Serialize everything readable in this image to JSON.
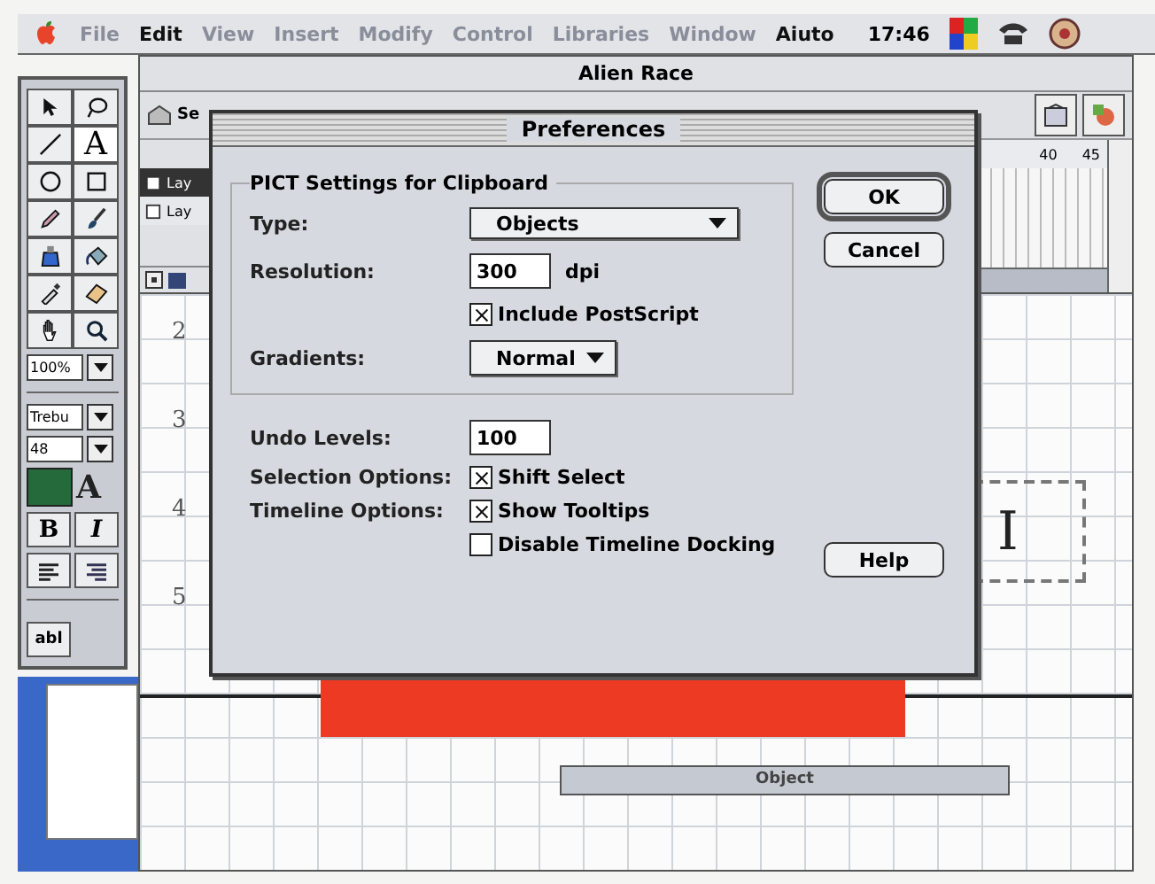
{
  "menu_bar": {
    "items": [
      {
        "label": "File",
        "disabled": true
      },
      {
        "label": "Edit",
        "disabled": false
      },
      {
        "label": "View",
        "disabled": true
      },
      {
        "label": "Insert",
        "disabled": true
      },
      {
        "label": "Modify",
        "disabled": true
      },
      {
        "label": "Control",
        "disabled": true
      },
      {
        "label": "Libraries",
        "disabled": true
      },
      {
        "label": "Window",
        "disabled": true
      },
      {
        "label": "Aiuto",
        "disabled": false
      }
    ],
    "clock": "17:46"
  },
  "window": {
    "title": "Alien Race"
  },
  "toolbar": {
    "scene_label": "Se"
  },
  "timeline": {
    "layers": [
      {
        "name": "Lay",
        "selected": true
      },
      {
        "name": "Lay",
        "selected": false
      }
    ],
    "ruler_labels": [
      "40",
      "45"
    ]
  },
  "tools": {
    "text_tool": "A",
    "zoom": "100%",
    "font": "Trebu",
    "size": "48",
    "text_color_label": "A",
    "bold": "B",
    "italic": "I",
    "text_field": "abl"
  },
  "stage": {
    "row_numbers": [
      "2",
      "3",
      "4",
      "5"
    ],
    "text_fragment": "I",
    "object_label": "Object"
  },
  "dialog": {
    "title": "Preferences",
    "group_title": "PICT Settings for Clipboard",
    "type": {
      "label": "Type:",
      "value": "Objects"
    },
    "resolution": {
      "label": "Resolution:",
      "value": "300",
      "unit": "dpi"
    },
    "include_postscript": {
      "label": "Include PostScript",
      "checked": true
    },
    "gradients": {
      "label": "Gradients:",
      "value": "Normal"
    },
    "undo_levels": {
      "label": "Undo Levels:",
      "value": "100"
    },
    "selection_options": {
      "label": "Selection Options:",
      "checkboxes": [
        {
          "label": "Shift Select",
          "checked": true
        }
      ]
    },
    "timeline_options": {
      "label": "Timeline Options:",
      "checkboxes": [
        {
          "label": "Show Tooltips",
          "checked": true
        },
        {
          "label": "Disable Timeline Docking",
          "checked": false
        }
      ]
    },
    "buttons": [
      {
        "label": "OK",
        "default": true
      },
      {
        "label": "Cancel",
        "default": false
      }
    ],
    "help_button": {
      "label": "Help"
    }
  }
}
